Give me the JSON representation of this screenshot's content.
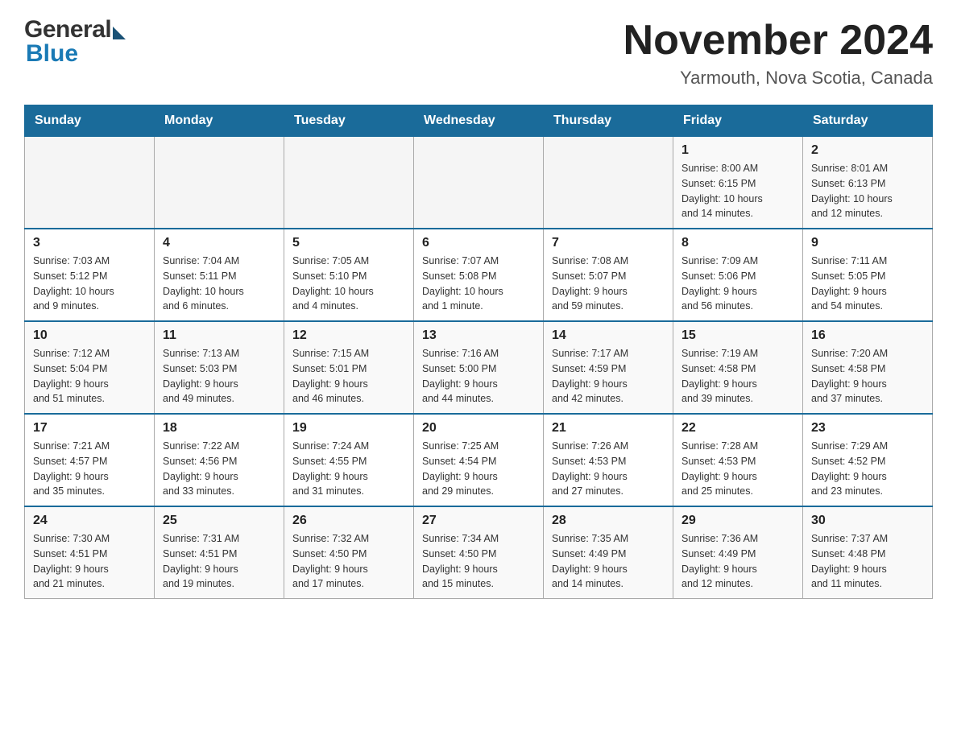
{
  "header": {
    "logo": {
      "general": "General",
      "blue": "Blue"
    },
    "title": "November 2024",
    "location": "Yarmouth, Nova Scotia, Canada"
  },
  "weekdays": [
    "Sunday",
    "Monday",
    "Tuesday",
    "Wednesday",
    "Thursday",
    "Friday",
    "Saturday"
  ],
  "weeks": [
    [
      {
        "day": "",
        "info": ""
      },
      {
        "day": "",
        "info": ""
      },
      {
        "day": "",
        "info": ""
      },
      {
        "day": "",
        "info": ""
      },
      {
        "day": "",
        "info": ""
      },
      {
        "day": "1",
        "info": "Sunrise: 8:00 AM\nSunset: 6:15 PM\nDaylight: 10 hours\nand 14 minutes."
      },
      {
        "day": "2",
        "info": "Sunrise: 8:01 AM\nSunset: 6:13 PM\nDaylight: 10 hours\nand 12 minutes."
      }
    ],
    [
      {
        "day": "3",
        "info": "Sunrise: 7:03 AM\nSunset: 5:12 PM\nDaylight: 10 hours\nand 9 minutes."
      },
      {
        "day": "4",
        "info": "Sunrise: 7:04 AM\nSunset: 5:11 PM\nDaylight: 10 hours\nand 6 minutes."
      },
      {
        "day": "5",
        "info": "Sunrise: 7:05 AM\nSunset: 5:10 PM\nDaylight: 10 hours\nand 4 minutes."
      },
      {
        "day": "6",
        "info": "Sunrise: 7:07 AM\nSunset: 5:08 PM\nDaylight: 10 hours\nand 1 minute."
      },
      {
        "day": "7",
        "info": "Sunrise: 7:08 AM\nSunset: 5:07 PM\nDaylight: 9 hours\nand 59 minutes."
      },
      {
        "day": "8",
        "info": "Sunrise: 7:09 AM\nSunset: 5:06 PM\nDaylight: 9 hours\nand 56 minutes."
      },
      {
        "day": "9",
        "info": "Sunrise: 7:11 AM\nSunset: 5:05 PM\nDaylight: 9 hours\nand 54 minutes."
      }
    ],
    [
      {
        "day": "10",
        "info": "Sunrise: 7:12 AM\nSunset: 5:04 PM\nDaylight: 9 hours\nand 51 minutes."
      },
      {
        "day": "11",
        "info": "Sunrise: 7:13 AM\nSunset: 5:03 PM\nDaylight: 9 hours\nand 49 minutes."
      },
      {
        "day": "12",
        "info": "Sunrise: 7:15 AM\nSunset: 5:01 PM\nDaylight: 9 hours\nand 46 minutes."
      },
      {
        "day": "13",
        "info": "Sunrise: 7:16 AM\nSunset: 5:00 PM\nDaylight: 9 hours\nand 44 minutes."
      },
      {
        "day": "14",
        "info": "Sunrise: 7:17 AM\nSunset: 4:59 PM\nDaylight: 9 hours\nand 42 minutes."
      },
      {
        "day": "15",
        "info": "Sunrise: 7:19 AM\nSunset: 4:58 PM\nDaylight: 9 hours\nand 39 minutes."
      },
      {
        "day": "16",
        "info": "Sunrise: 7:20 AM\nSunset: 4:58 PM\nDaylight: 9 hours\nand 37 minutes."
      }
    ],
    [
      {
        "day": "17",
        "info": "Sunrise: 7:21 AM\nSunset: 4:57 PM\nDaylight: 9 hours\nand 35 minutes."
      },
      {
        "day": "18",
        "info": "Sunrise: 7:22 AM\nSunset: 4:56 PM\nDaylight: 9 hours\nand 33 minutes."
      },
      {
        "day": "19",
        "info": "Sunrise: 7:24 AM\nSunset: 4:55 PM\nDaylight: 9 hours\nand 31 minutes."
      },
      {
        "day": "20",
        "info": "Sunrise: 7:25 AM\nSunset: 4:54 PM\nDaylight: 9 hours\nand 29 minutes."
      },
      {
        "day": "21",
        "info": "Sunrise: 7:26 AM\nSunset: 4:53 PM\nDaylight: 9 hours\nand 27 minutes."
      },
      {
        "day": "22",
        "info": "Sunrise: 7:28 AM\nSunset: 4:53 PM\nDaylight: 9 hours\nand 25 minutes."
      },
      {
        "day": "23",
        "info": "Sunrise: 7:29 AM\nSunset: 4:52 PM\nDaylight: 9 hours\nand 23 minutes."
      }
    ],
    [
      {
        "day": "24",
        "info": "Sunrise: 7:30 AM\nSunset: 4:51 PM\nDaylight: 9 hours\nand 21 minutes."
      },
      {
        "day": "25",
        "info": "Sunrise: 7:31 AM\nSunset: 4:51 PM\nDaylight: 9 hours\nand 19 minutes."
      },
      {
        "day": "26",
        "info": "Sunrise: 7:32 AM\nSunset: 4:50 PM\nDaylight: 9 hours\nand 17 minutes."
      },
      {
        "day": "27",
        "info": "Sunrise: 7:34 AM\nSunset: 4:50 PM\nDaylight: 9 hours\nand 15 minutes."
      },
      {
        "day": "28",
        "info": "Sunrise: 7:35 AM\nSunset: 4:49 PM\nDaylight: 9 hours\nand 14 minutes."
      },
      {
        "day": "29",
        "info": "Sunrise: 7:36 AM\nSunset: 4:49 PM\nDaylight: 9 hours\nand 12 minutes."
      },
      {
        "day": "30",
        "info": "Sunrise: 7:37 AM\nSunset: 4:48 PM\nDaylight: 9 hours\nand 11 minutes."
      }
    ]
  ]
}
